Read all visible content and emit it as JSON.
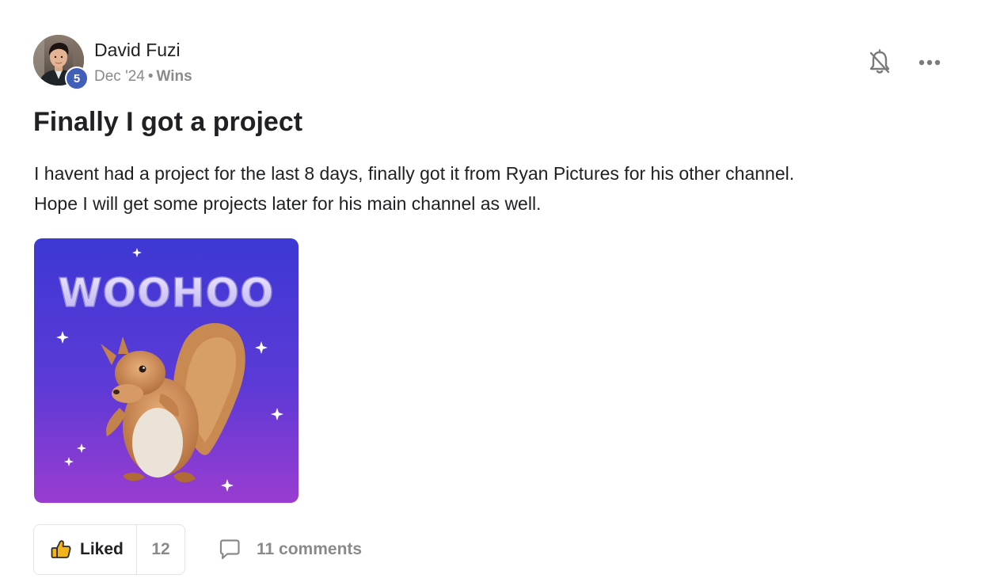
{
  "author": {
    "name": "David Fuzi",
    "level": "5",
    "avatar_icon": "user-photo"
  },
  "meta": {
    "date": "Dec '24",
    "separator": "•",
    "category": "Wins"
  },
  "header_actions": {
    "bell_icon": "bell-off-icon",
    "more_icon": "more-horizontal-icon"
  },
  "post": {
    "title": "Finally I got a project",
    "body_lines": [
      "I havent had a project for the last 8 days, finally got it from Ryan Pictures for his other channel.",
      "Hope I will get some projects later for his main channel as well."
    ],
    "gif_text": "WOOHOO",
    "gif_colors": {
      "top": "#3d38d4",
      "bottom": "#9a3cd0"
    }
  },
  "actions": {
    "like_label": "Liked",
    "like_count": "12",
    "comments_label": "11 comments",
    "like_icon": "thumbs-up-icon",
    "comment_icon": "comment-icon"
  },
  "colors": {
    "badge": "#3f5fb8",
    "muted": "#8a8a8a",
    "text": "#202124",
    "thumb": "#f2b31b"
  }
}
